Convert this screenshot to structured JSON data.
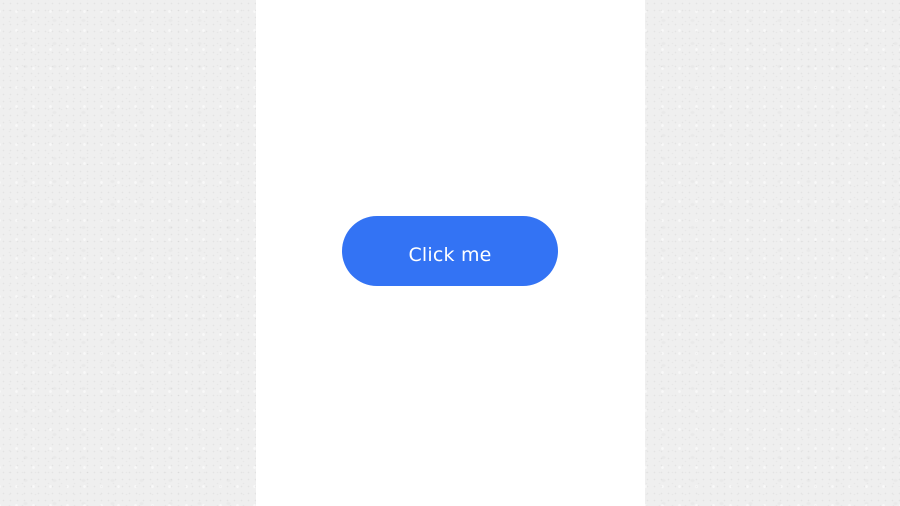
{
  "page": {
    "background_texture": "light-gray-concrete",
    "panel_color": "#ffffff"
  },
  "button": {
    "label": "Click me",
    "color": "#3373f4",
    "text_color": "#ffffff"
  }
}
